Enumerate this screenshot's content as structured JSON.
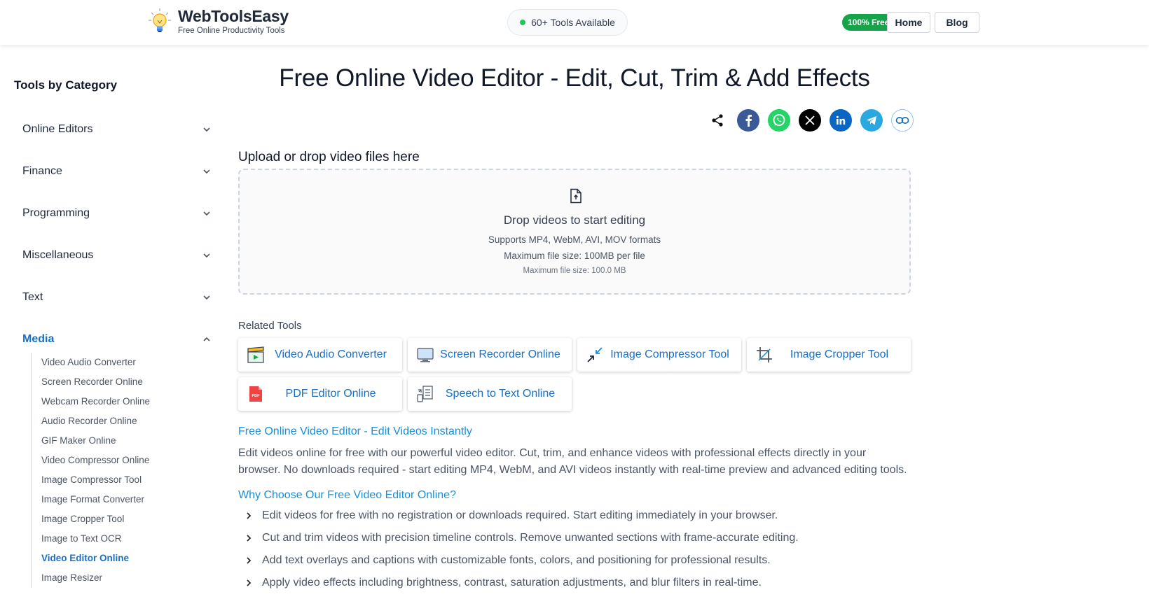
{
  "header": {
    "brand_title": "WebToolsEasy",
    "brand_subtitle": "Free Online Productivity Tools",
    "tools_pill": "60+ Tools Available",
    "free_badge": "100% Free",
    "nav": [
      "Home",
      "Blog"
    ]
  },
  "sidebar": {
    "title": "Tools by Category",
    "categories": [
      {
        "label": "Online Editors",
        "expanded": false
      },
      {
        "label": "Finance",
        "expanded": false
      },
      {
        "label": "Programming",
        "expanded": false
      },
      {
        "label": "Miscellaneous",
        "expanded": false
      },
      {
        "label": "Text",
        "expanded": false
      },
      {
        "label": "Media",
        "expanded": true
      }
    ],
    "media_items": [
      "Video Audio Converter",
      "Screen Recorder Online",
      "Webcam Recorder Online",
      "Audio Recorder Online",
      "GIF Maker Online",
      "Video Compressor Online",
      "Image Compressor Tool",
      "Image Format Converter",
      "Image Cropper Tool",
      "Image to Text OCR",
      "Video Editor Online",
      "Image Resizer"
    ],
    "active_item": "Video Editor Online"
  },
  "main": {
    "title": "Free Online Video Editor - Edit, Cut, Trim & Add Effects",
    "share_icons": [
      "share-icon",
      "facebook-icon",
      "whatsapp-icon",
      "x-icon",
      "linkedin-icon",
      "telegram-icon",
      "link-icon"
    ],
    "upload_label": "Upload or drop video files here",
    "dropzone": {
      "title": "Drop videos to start editing",
      "formats": "Supports MP4, WebM, AVI, MOV formats",
      "max_size": "Maximum file size: 100MB per file",
      "max_size_small": "Maximum file size: 100.0 MB"
    },
    "related_label": "Related Tools",
    "related_tools": [
      "Video Audio Converter",
      "Screen Recorder Online",
      "Image Compressor Tool",
      "Image Cropper Tool",
      "PDF Editor Online",
      "Speech to Text Online"
    ],
    "intro_heading": "Free Online Video Editor - Edit Videos Instantly",
    "intro_text": "Edit videos online for free with our powerful video editor. Cut, trim, and enhance videos with professional effects directly in your browser. No downloads required - start editing MP4, WebM, and AVI videos instantly with real-time preview and advanced editing tools.",
    "why_heading": "Why Choose Our Free Video Editor Online?",
    "why_points": [
      "Edit videos for free with no registration or downloads required. Start editing immediately in your browser.",
      "Cut and trim videos with precision timeline controls. Remove unwanted sections with frame-accurate editing.",
      "Add text overlays and captions with customizable fonts, colors, and positioning for professional results.",
      "Apply video effects including brightness, contrast, saturation adjustments, and blur filters in real-time."
    ]
  },
  "colors": {
    "accent": "#1a6fc4",
    "heading_link": "#1a8fd8",
    "free_badge": "#16a34a",
    "facebook": "#3b5998",
    "whatsapp": "#25d366",
    "x": "#000000",
    "linkedin": "#0a66c2",
    "telegram": "#2aa9e0"
  }
}
